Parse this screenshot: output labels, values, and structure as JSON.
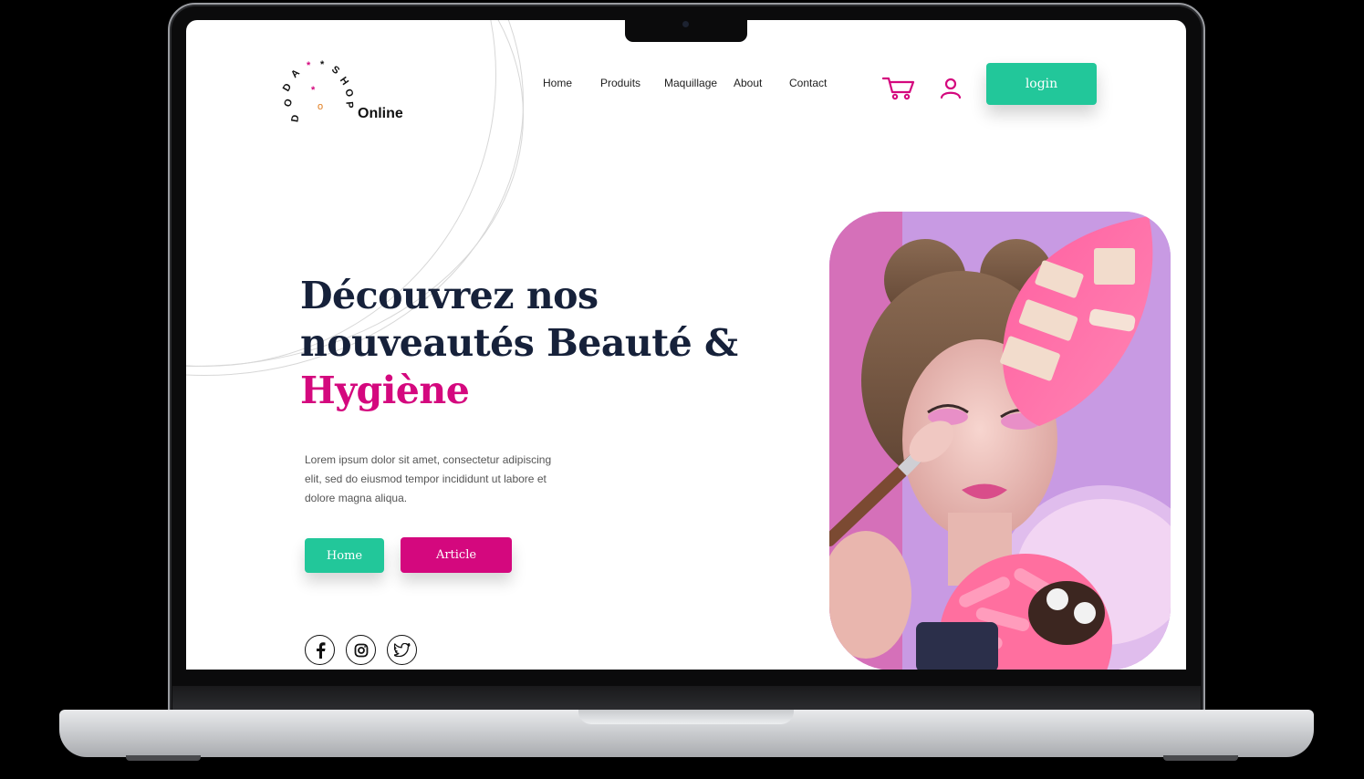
{
  "brand": {
    "ring_text": "DODA**SHOP",
    "online": "Online",
    "colors": {
      "green": "#22c79a",
      "pink": "#d4087e",
      "navy": "#16213a"
    }
  },
  "nav": {
    "items": [
      "Home",
      "Produits",
      "Maquillage",
      "About",
      "Contact"
    ]
  },
  "header": {
    "cart_icon": "cart-icon",
    "user_icon": "user-icon",
    "login_label": "login"
  },
  "hero": {
    "title_line1": "Découvrez nos",
    "title_line2": "nouveautés Beauté &",
    "title_highlight": "Hygiène",
    "description": "Lorem ipsum dolor sit amet, consectetur adipiscing elit, sed do eiusmod tempor incididunt ut labore et dolore magna aliqua.",
    "btn_home": "Home",
    "btn_article": "Article"
  },
  "social": [
    "facebook-icon",
    "instagram-icon",
    "twitter-icon"
  ]
}
